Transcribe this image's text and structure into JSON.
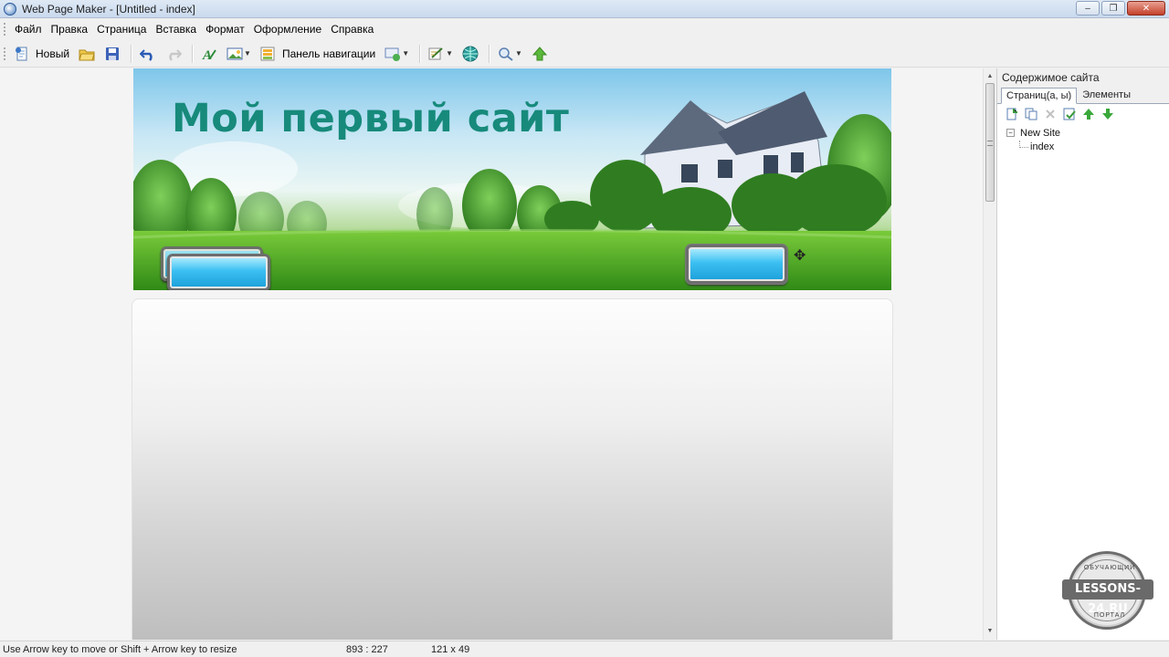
{
  "window": {
    "title": "Web Page Maker - [Untitled - index]",
    "minimize": "‒",
    "maximize": "❐",
    "close": "✕"
  },
  "menu": {
    "items": [
      "Файл",
      "Правка",
      "Страница",
      "Вставка",
      "Формат",
      "Оформление",
      "Справка"
    ]
  },
  "toolbar": {
    "new_label": "Новый",
    "navpanel_label": "Панель навигации"
  },
  "canvas": {
    "site_title": "Мой первый сайт"
  },
  "side_panel": {
    "title": "Содержимое сайта",
    "tabs": [
      "Страниц(а, ы)",
      "Элементы"
    ],
    "active_tab": "Страниц(а, ы)",
    "tree": {
      "root": "New Site",
      "toggle": "−",
      "children": [
        "index"
      ]
    }
  },
  "statusbar": {
    "message": "Use Arrow key to move or Shift + Arrow key to resize",
    "coords": "893 : 227",
    "size": "121 x 49"
  },
  "watermark": {
    "top_text": "ОБУЧАЮЩИЙ",
    "band_text": "LESSONS-24.RU",
    "bottom_text": "ПОРТАЛ"
  },
  "colors": {
    "title_teal": "#178a7b",
    "button_blue": "#3cc0f2",
    "grass_green": "#3e951d"
  }
}
